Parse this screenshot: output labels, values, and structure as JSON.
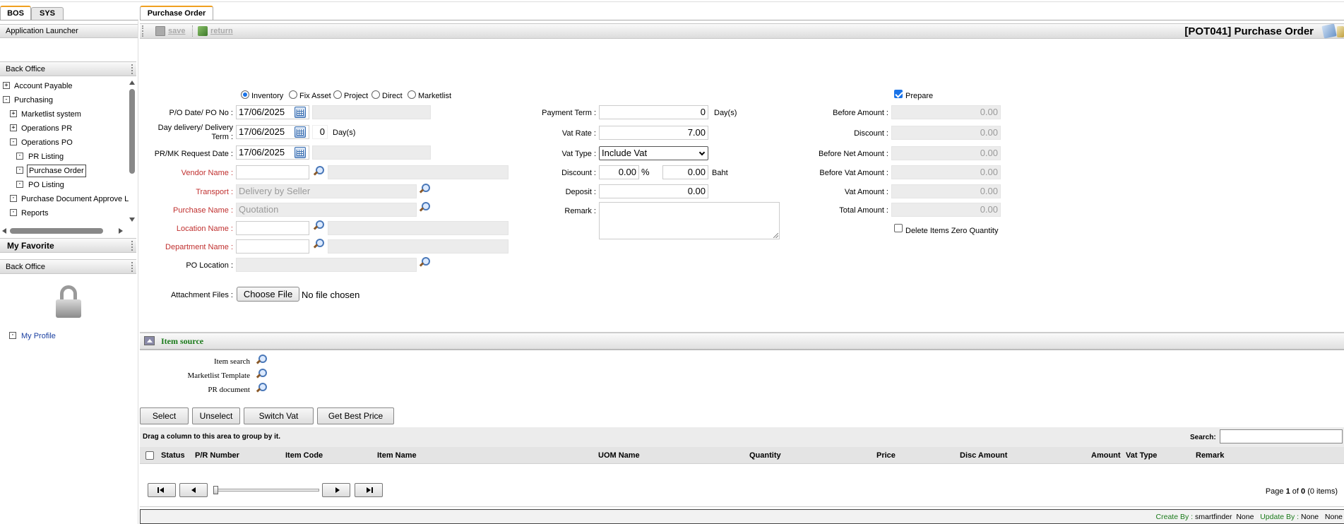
{
  "top_tabs": {
    "bos": "BOS",
    "sys": "SYS",
    "purchase_order": "Purchase Order"
  },
  "sidebar": {
    "launcher": "Application Launcher",
    "section1": "Back Office",
    "tree": [
      {
        "label": "Account Payable",
        "sign": "+"
      },
      {
        "label": "Purchasing",
        "sign": "-"
      },
      {
        "label": "Marketlist system",
        "sign": "+"
      },
      {
        "label": "Operations PR",
        "sign": "+"
      },
      {
        "label": "Operations PO",
        "sign": "-"
      },
      {
        "label": "PR Listing",
        "sign": "·"
      },
      {
        "label": "Purchase Order",
        "sign": "·"
      },
      {
        "label": "PO Listing",
        "sign": "·"
      },
      {
        "label": "Purchase Document Approve L",
        "sign": "·"
      },
      {
        "label": "Reports",
        "sign": "·"
      }
    ],
    "favorite": "My Favorite",
    "section2": "Back Office",
    "my_profile": "My Profile"
  },
  "toolbar": {
    "save": "save",
    "return": "return",
    "title": "[POT041] Purchase Order"
  },
  "form": {
    "po_types": [
      "Inventory",
      "Fix Asset",
      "Project",
      "Direct",
      "Marketlist"
    ],
    "selected_type": "Inventory",
    "po_date_label": "P/O Date/ PO No :",
    "po_date": "17/06/2025",
    "delivery_label_1": "Day delivery/ Delivery",
    "delivery_label_2": "Term :",
    "delivery_date": "17/06/2025",
    "delivery_days": "0",
    "delivery_unit": "Day(s)",
    "pr_date_label": "PR/MK Request Date :",
    "pr_date": "17/06/2025",
    "vendor_label": "Vendor Name :",
    "transport_label": "Transport :",
    "transport_value": "Delivery by Seller",
    "purchase_name_label": "Purchase Name :",
    "purchase_name_value": "Quotation",
    "location_label": "Location Name :",
    "department_label": "Department Name :",
    "po_location_label": "PO Location :",
    "attach_label": "Attachment Files :",
    "choose_file": "Choose File",
    "no_file": "No file chosen",
    "payment_term_label": "Payment Term :",
    "payment_term": "0",
    "payment_term_unit": "Day(s)",
    "vat_rate_label": "Vat Rate :",
    "vat_rate": "7.00",
    "vat_type_label": "Vat Type :",
    "vat_type": "Include Vat",
    "discount_label": "Discount :",
    "discount_pct": "0.00",
    "pct_sign": "%",
    "discount_amt": "0.00",
    "baht": "Baht",
    "deposit_label": "Deposit :",
    "deposit": "0.00",
    "remark_label": "Remark :",
    "prepare": "Prepare",
    "before_amount_label": "Before Amount :",
    "before_amount": "0.00",
    "discount2_label": "Discount :",
    "discount2": "0.00",
    "before_net_label": "Before Net Amount :",
    "before_net": "0.00",
    "before_vat_label": "Before Vat Amount :",
    "before_vat": "0.00",
    "vat_amount_label": "Vat Amount :",
    "vat_amount": "0.00",
    "total_amount_label": "Total Amount :",
    "total_amount": "0.00",
    "delete_zero": "Delete Items Zero Quantity"
  },
  "item_source": {
    "title": "Item source",
    "item_search": "Item search",
    "marketlist_template": "Marketlist Template",
    "pr_document": "PR document"
  },
  "buttons": {
    "select": "Select",
    "unselect": "Unselect",
    "switch_vat": "Switch Vat",
    "best_price": "Get Best Price"
  },
  "grid": {
    "group_hint": "Drag a column to this area to group by it.",
    "search_label": "Search:",
    "columns": [
      "Status",
      "P/R Number",
      "Item Code",
      "Item Name",
      "UOM Name",
      "Quantity",
      "Price",
      "Disc Amount",
      "Amount",
      "Vat Type",
      "Remark"
    ],
    "page_prefix": "Page",
    "page_current": "1",
    "page_of": "of",
    "page_total": "0",
    "items": "(0 items)"
  },
  "footer": {
    "create_by_label": "Create By :",
    "create_by": "smartfinder",
    "none1": "None",
    "update_by_label": "Update By :",
    "none2": "None",
    "none3": "None"
  },
  "colors": {
    "accent_orange": "#f0a020",
    "required_red": "#c0302f",
    "green": "#1a7a1a",
    "link_blue": "#1a3fa0"
  }
}
